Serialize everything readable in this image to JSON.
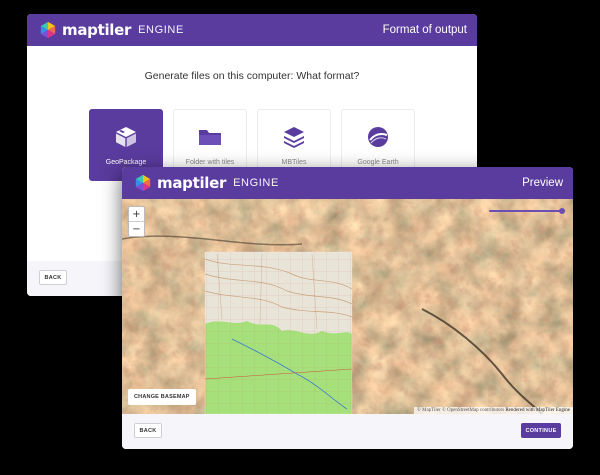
{
  "brand": {
    "name": "maptiler",
    "product": "ENGINE"
  },
  "format_window": {
    "title": "Format of output",
    "question": "Generate files on this computer: What format?",
    "formats": [
      {
        "label": "GeoPackage",
        "icon": "geopackage-icon",
        "selected": true
      },
      {
        "label": "Folder with tiles",
        "icon": "folder-icon",
        "selected": false
      },
      {
        "label": "MBTiles",
        "icon": "layers-icon",
        "selected": false
      },
      {
        "label": "Google Earth",
        "icon": "globe-icon",
        "selected": false
      }
    ],
    "back_label": "BACK"
  },
  "preview_window": {
    "title": "Preview",
    "zoom_in": "+",
    "zoom_out": "−",
    "change_basemap": "CHANGE BASEMAP",
    "attribution": "© MapTiler © OpenStreetMap contributors",
    "rendered_by": "Rendered with MapTiler Engine",
    "back_label": "BACK",
    "continue_label": "CONTINUE",
    "opacity_slider_value": 1.0
  },
  "colors": {
    "brand_purple": "#5a3b9e",
    "terrain_dark": "#4a3e2e",
    "terrain_red": "#8a4a30",
    "topo_green": "#a6e07a"
  }
}
